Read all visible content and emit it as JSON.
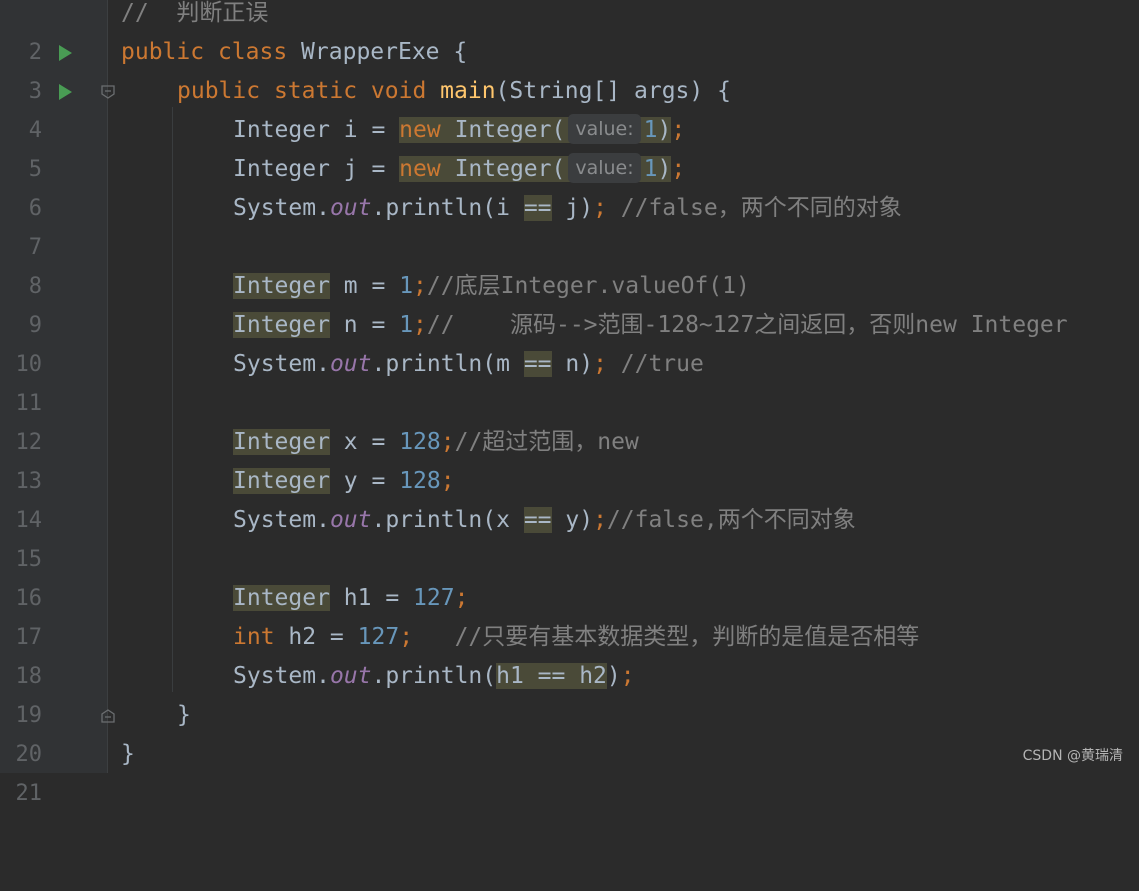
{
  "editor": {
    "lines": [
      {
        "number": "2",
        "comment": "//  判断正误"
      },
      {
        "number": "3",
        "kw_public": "public",
        "kw_class": "class",
        "class_name": " WrapperExe {"
      },
      {
        "number": "4",
        "kw_public": "public",
        "kw_static": "static",
        "kw_void": "void",
        "method_name": "main",
        "params": "(String[] args) {"
      },
      {
        "number": "5",
        "decl": "Integer i = ",
        "kw_new": "new",
        "ctor": " Integer(",
        "hint": "value:",
        "arg": "1",
        "close": ")",
        "semi": ";"
      },
      {
        "number": "6",
        "decl": "Integer j = ",
        "kw_new": "new",
        "ctor": " Integer(",
        "hint": "value:",
        "arg": "1",
        "close": ")",
        "semi": ";"
      },
      {
        "number": "7",
        "sys": "System.",
        "out": "out",
        "call_open": ".println(i ",
        "op": "==",
        "call_close": " j)",
        "semi": ";",
        "comment": " //false，两个不同的对象"
      },
      {
        "number": "8"
      },
      {
        "number": "9",
        "type": "Integer",
        "rest": " m = ",
        "val": "1",
        "semi": ";",
        "comment": "//底层Integer.valueOf(1)"
      },
      {
        "number": "10",
        "type": "Integer",
        "rest": " n = ",
        "val": "1",
        "semi": ";",
        "comment": "//    源码-->范围-128~127之间返回，否则new Integer"
      },
      {
        "number": "11",
        "sys": "System.",
        "out": "out",
        "call_open": ".println(m ",
        "op": "==",
        "call_close": " n)",
        "semi": ";",
        "comment": " //true"
      },
      {
        "number": "12"
      },
      {
        "number": "13",
        "type": "Integer",
        "rest": " x = ",
        "val": "128",
        "semi": ";",
        "comment": "//超过范围，new"
      },
      {
        "number": "14",
        "type": "Integer",
        "rest": " y = ",
        "val": "128",
        "semi": ";"
      },
      {
        "number": "15",
        "sys": "System.",
        "out": "out",
        "call_open": ".println(x ",
        "op": "==",
        "call_close": " y)",
        "semi": ";",
        "comment": "//false,两个不同对象"
      },
      {
        "number": "16"
      },
      {
        "number": "17",
        "type": "Integer",
        "rest": " h1 = ",
        "val": "127",
        "semi": ";"
      },
      {
        "number": "18",
        "kw_int": "int",
        "rest": " h2 = ",
        "val": "127",
        "semi": ";",
        "comment": "   //只要有基本数据类型，判断的是值是否相等"
      },
      {
        "number": "19",
        "sys": "System.",
        "out": "out",
        "call_open": ".println(",
        "expr": "h1 == h2",
        "call_close": ")",
        "semi": ";"
      },
      {
        "number": "20",
        "brace": "}"
      },
      {
        "number": "21",
        "brace": "}"
      }
    ]
  },
  "watermark": "CSDN @黄瑞清",
  "colors": {
    "keyword": "#cc7832",
    "number": "#6897bb",
    "comment": "#808080",
    "static_field": "#9876aa",
    "method": "#ffc66d",
    "run_icon": "#499c54"
  }
}
